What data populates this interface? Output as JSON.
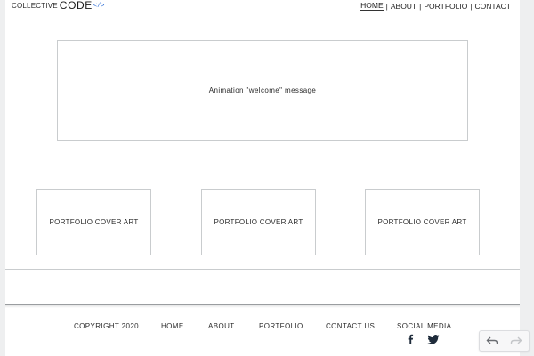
{
  "header": {
    "logo_small": "COLLECTIVE",
    "logo_big": "CODE",
    "logo_tag": "</>",
    "nav": [
      {
        "label": "HOME"
      },
      {
        "label": "ABOUT"
      },
      {
        "label": "PORTFOLIO"
      },
      {
        "label": "CONTACT"
      }
    ],
    "separator": "|"
  },
  "hero": {
    "welcome": "Animation \"welcome\" message"
  },
  "portfolio": {
    "cards": [
      {
        "label": "PORTFOLIO COVER ART"
      },
      {
        "label": "PORTFOLIO COVER ART"
      },
      {
        "label": "PORTFOLIO COVER ART"
      }
    ]
  },
  "footer": {
    "copyright": "COPYRIGHT 2020",
    "links": [
      {
        "label": "HOME"
      },
      {
        "label": "ABOUT"
      },
      {
        "label": "PORTFOLIO"
      },
      {
        "label": "CONTACT US"
      },
      {
        "label": "SOCIAL MEDIA"
      }
    ],
    "social_icons": [
      "facebook-icon",
      "twitter-icon"
    ]
  },
  "toolbar": {
    "icons": [
      "undo-icon",
      "redo-icon"
    ]
  },
  "colors": {
    "logo_tag": "#2f6fd6",
    "border": "#c9ccce",
    "text": "#2b2b2b"
  }
}
